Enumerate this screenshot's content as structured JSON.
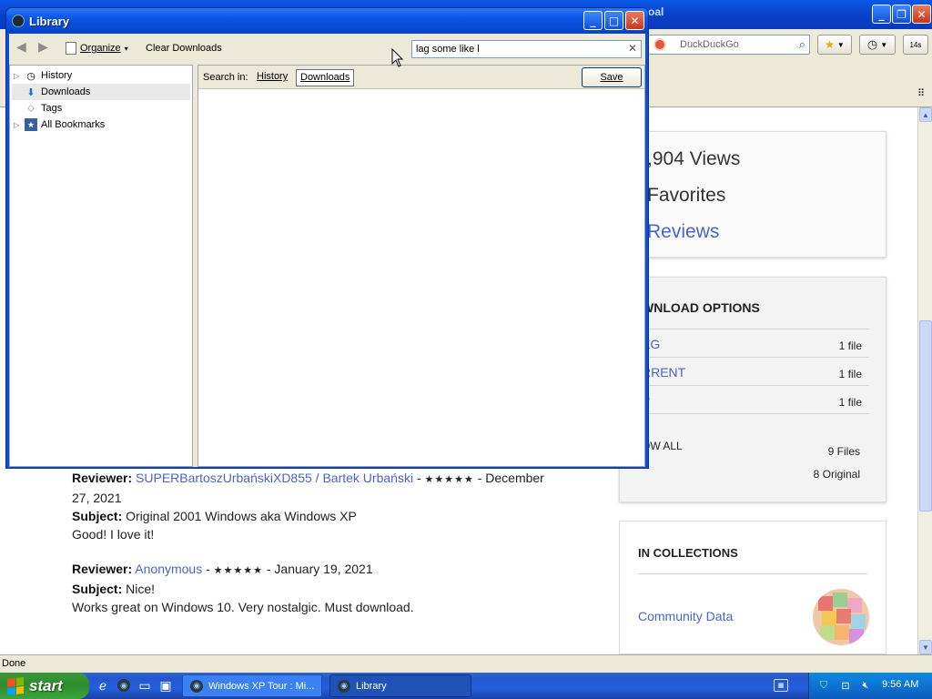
{
  "browser": {
    "title_partial": "oal",
    "search_placeholder": "DuckDuckGo",
    "badge": "14s"
  },
  "page": {
    "stats": {
      "views": ",904 Views",
      "favorites": "Favorites",
      "reviews": "Reviews"
    },
    "download_options": {
      "heading": "WNLOAD OPTIONS",
      "rows": [
        {
          "name": "EG",
          "count": "1 file"
        },
        {
          "name": "RRENT",
          "count": "1 file"
        },
        {
          "name": "P",
          "count": "1 file"
        }
      ],
      "show_all": "OW ALL",
      "files": "9 Files",
      "original": "8 Original"
    },
    "collections": {
      "heading": "IN COLLECTIONS",
      "link": "Community Data"
    },
    "reviews": [
      {
        "label": "Reviewer:",
        "name": "SUPERBartoszUrbańskiXD855 / Bartek Urbański",
        "stars": "★★★★★",
        "date_line1": " - December",
        "date_line2": "27, 2021",
        "subject_label": "Subject:",
        "subject": " Original 2001 Windows aka Windows XP",
        "body": "Good! I love it!"
      },
      {
        "label": "Reviewer:",
        "name": "Anonymous",
        "stars": "★★★★★",
        "date_line1": " - January 19, 2021",
        "subject_label": "Subject:",
        "subject": " Nice!",
        "body": "Works great on Windows 10. Very nostalgic. Must download."
      }
    ]
  },
  "statusbar": {
    "text": "Done"
  },
  "library": {
    "title": "Library",
    "toolbar": {
      "organize": "Organize",
      "clear_downloads": "Clear Downloads"
    },
    "search_value": "lag some like l",
    "tree": [
      "History",
      "Downloads",
      "Tags",
      "All Bookmarks"
    ],
    "scope": {
      "label": "Search in:",
      "history": "History",
      "downloads": "Downloads",
      "save": "Save"
    }
  },
  "taskbar": {
    "start": "start",
    "tasks": [
      "Windows XP Tour : Mi...",
      "Library"
    ],
    "clock": "9:56 AM"
  },
  "colors": {
    "link": "#4a64c8",
    "xp_blue": "#0a55e6",
    "start_green": "#3aa63a"
  }
}
